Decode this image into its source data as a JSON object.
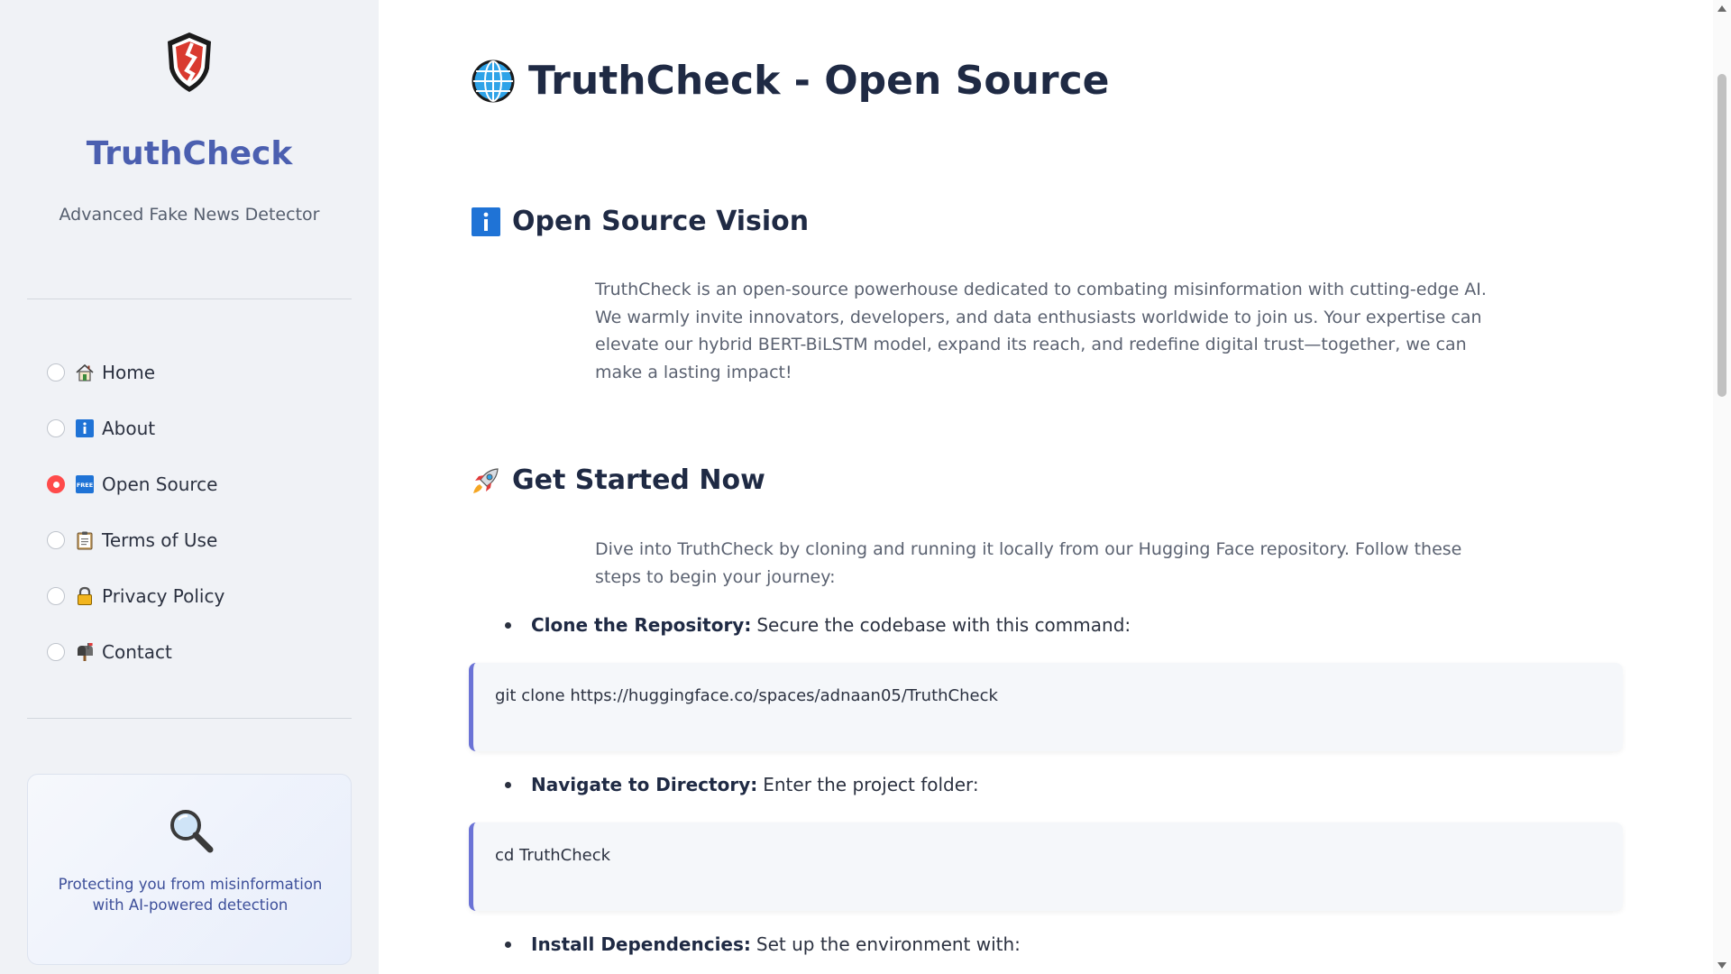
{
  "sidebar": {
    "brand": "TruthCheck",
    "tagline": "Advanced Fake News Detector",
    "nav": [
      {
        "label": "Home",
        "icon": "house-icon",
        "selected": false
      },
      {
        "label": "About",
        "icon": "info-icon",
        "selected": false
      },
      {
        "label": "Open Source",
        "icon": "free-icon",
        "selected": true
      },
      {
        "label": "Terms of Use",
        "icon": "clipboard-icon",
        "selected": false
      },
      {
        "label": "Privacy Policy",
        "icon": "lock-icon",
        "selected": false
      },
      {
        "label": "Contact",
        "icon": "mailbox-icon",
        "selected": false
      }
    ],
    "card_text": "Protecting you from misinformation with AI-powered detection"
  },
  "main": {
    "title": "TruthCheck - Open Source",
    "vision": {
      "heading": "Open Source Vision",
      "text": "TruthCheck is an open-source powerhouse dedicated to combating misinformation with cutting-edge AI. We warmly invite innovators, developers, and data enthusiasts worldwide to join us. Your expertise can elevate our hybrid BERT-BiLSTM model, expand its reach, and redefine digital trust—together, we can make a lasting impact!"
    },
    "get_started": {
      "heading": "Get Started Now",
      "text": "Dive into TruthCheck by cloning and running it locally from our Hugging Face repository. Follow these steps to begin your journey:",
      "steps": [
        {
          "title": "Clone the Repository:",
          "desc": "Secure the codebase with this command:",
          "code": "git clone https://huggingface.co/spaces/adnaan05/TruthCheck"
        },
        {
          "title": "Navigate to Directory:",
          "desc": "Enter the project folder:",
          "code": "cd TruthCheck"
        },
        {
          "title": "Install Dependencies:",
          "desc": "Set up the environment with:"
        }
      ]
    }
  },
  "colors": {
    "brand": "#4b5fb0",
    "radio_active": "#ff4b4b",
    "code_accent": "#6b73d6",
    "sidebar_bg": "#f0f2f6"
  }
}
